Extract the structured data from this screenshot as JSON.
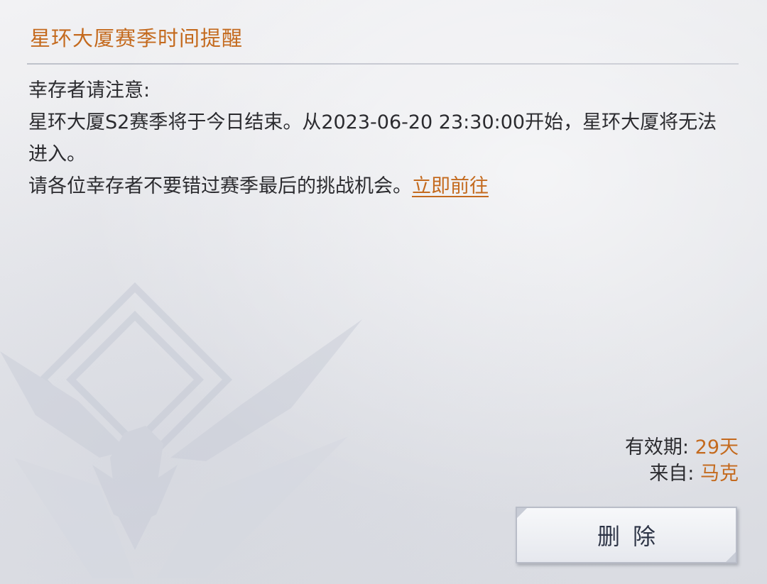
{
  "mail": {
    "title": "星环大厦赛季时间提醒",
    "body": {
      "greeting": "幸存者请注意:",
      "line1": "星环大厦S2赛季将于今日结束。从2023-06-20 23:30:00开始，星环大厦将无法",
      "line2": "进入。",
      "line3_text": "请各位幸存者不要错过赛季最后的挑战机会。",
      "link_label": "立即前往"
    },
    "meta": {
      "validity_label": "有效期:",
      "validity_value": "29天",
      "from_label": "来自:",
      "from_value": "马克"
    },
    "actions": {
      "delete_label": "删除"
    }
  },
  "colors": {
    "accent": "#c46a1e",
    "text": "#2b2b2f",
    "button_text": "#2d3446"
  }
}
